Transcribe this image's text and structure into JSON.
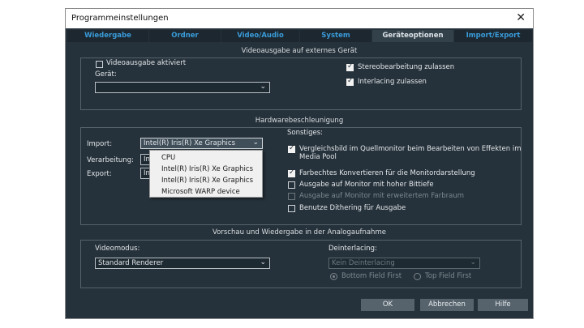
{
  "window": {
    "title": "Programmeinstellungen",
    "close": "✕"
  },
  "tabs": [
    "Wiedergabe",
    "Ordner",
    "Video/Audio",
    "System",
    "Geräteoptionen",
    "Import/Export"
  ],
  "external": {
    "title": "Videoausgabe auf externes Gerät",
    "video_out_label": "Videoausgabe aktiviert",
    "device_label": "Gerät:",
    "device_value": "",
    "stereo_label": "Stereobearbeitung zulassen",
    "interlacing_label": "Interlacing zulassen"
  },
  "hardware": {
    "title": "Hardwarebeschleunigung",
    "import_label": "Import:",
    "import_value": "Intel(R) Iris(R) Xe Graphics",
    "processing_label": "Verarbeitung:",
    "processing_value": "In",
    "export_label": "Export:",
    "export_value": "In",
    "options": [
      "CPU",
      "Intel(R) Iris(R) Xe Graphics",
      "Intel(R) Iris(R) Xe Graphics",
      "Microsoft WARP device"
    ],
    "misc_label": "Sonstiges:",
    "compare_label_1": "Vergleichsbild im Quellmonitor beim Bearbeiten von Effekten im",
    "compare_label_2": "Media Pool",
    "colorconv_label": "Farbechtes Konvertieren für die Monitordarstellung",
    "highbit_label": "Ausgabe auf Monitor mit hoher Bittiefe",
    "widegamut_label": "Ausgabe auf Monitor mit erweitertem Farbraum",
    "dither_label": "Benutze Dithering für Ausgabe"
  },
  "analog": {
    "title": "Vorschau und Wiedergabe in der Analogaufnahme",
    "videomode_label": "Videomodus:",
    "videomode_value": "Standard Renderer",
    "deinterlace_label": "Deinterlacing:",
    "deinterlace_value": "Kein Deinterlacing",
    "bottom_label": "Bottom Field First",
    "top_label": "Top Field First"
  },
  "buttons": {
    "ok": "OK",
    "cancel": "Abbrechen",
    "help": "Hilfe"
  }
}
